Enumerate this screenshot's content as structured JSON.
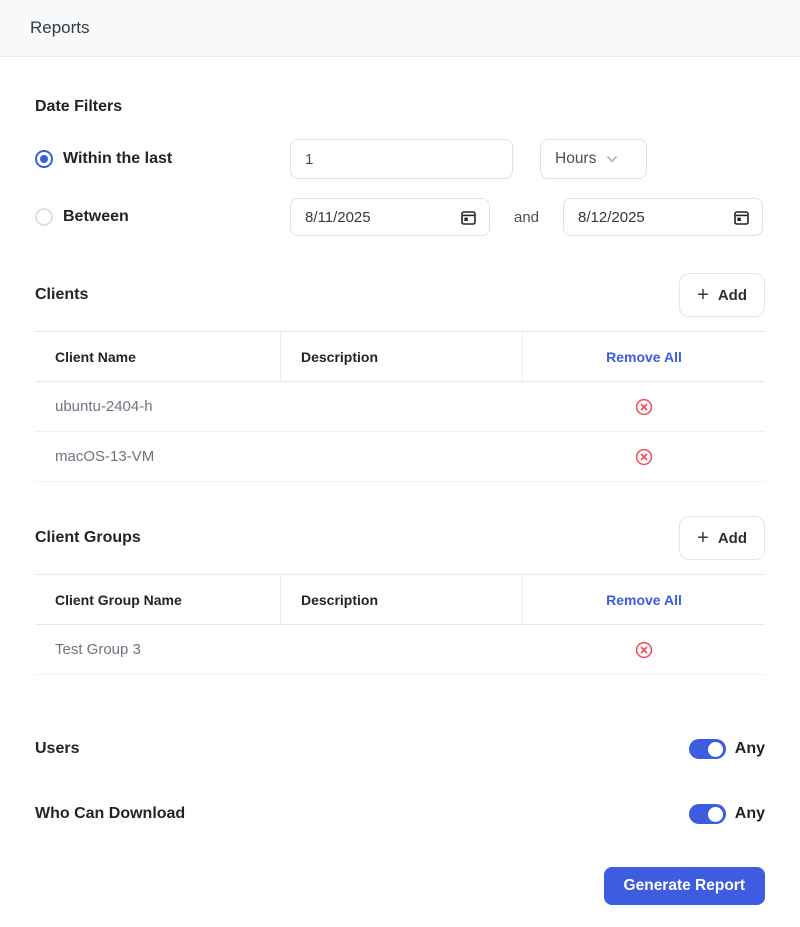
{
  "header": {
    "title": "Reports"
  },
  "date_filters": {
    "title": "Date Filters",
    "within": {
      "label": "Within the last",
      "value": "1",
      "unit": "Hours",
      "selected": true
    },
    "between": {
      "label": "Between",
      "start_date": "8/11/2025",
      "conjunction": "and",
      "end_date": "8/12/2025",
      "selected": false
    }
  },
  "clients": {
    "title": "Clients",
    "add_label": "Add",
    "columns": [
      "Client Name",
      "Description",
      "Remove All"
    ],
    "rows": [
      {
        "name": "ubuntu-2404-h",
        "description": ""
      },
      {
        "name": "macOS-13-VM",
        "description": ""
      }
    ]
  },
  "client_groups": {
    "title": "Client Groups",
    "add_label": "Add",
    "columns": [
      "Client Group Name",
      "Description",
      "Remove All"
    ],
    "rows": [
      {
        "name": "Test Group 3",
        "description": ""
      }
    ]
  },
  "toggles": [
    {
      "label": "Users",
      "state": "Any",
      "on": true
    },
    {
      "label": "Who Can Download",
      "state": "Any",
      "on": true
    }
  ],
  "actions": {
    "generate_label": "Generate Report"
  },
  "icons": {
    "plus": "+"
  },
  "colors": {
    "accent": "#3d5cdf",
    "danger": "#f4485c",
    "header_bg": "#f8f9fa",
    "row_text": "#6f7681"
  }
}
